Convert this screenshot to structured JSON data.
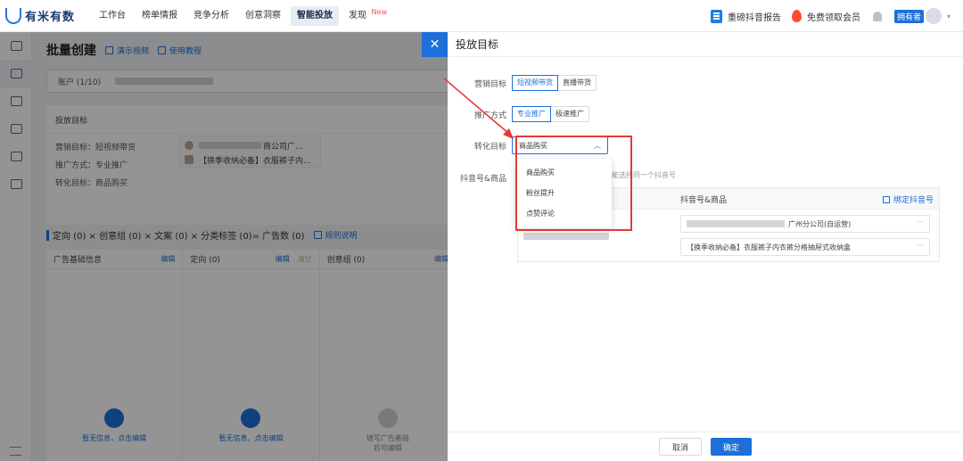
{
  "brand": {
    "name": "有米有数"
  },
  "nav": {
    "items": [
      "工作台",
      "榜单情报",
      "竞争分析",
      "创意洞察",
      "智能投放",
      "发现"
    ],
    "active_index": 4,
    "new_badge": "New"
  },
  "top_right": {
    "report_label": "重磅抖音报告",
    "vip_label": "免费领取会员",
    "owner_badge": "拥有者"
  },
  "page": {
    "title": "批量创建",
    "demo_video": "演示视频",
    "tutorial": "使用教程",
    "account_label": "账户 (1/10)",
    "card_title": "投放目标",
    "kv": {
      "marketing": "营销目标：短视频带货",
      "promotion": "推广方式：专业推广",
      "conversion": "转化目标：商品购买"
    },
    "product_suffix": "商公司广...",
    "product_title": "【换季收纳必备】衣服裤子内...",
    "stats_text": "定向 (0) × 创意组 (0) × 文案 (0) × 分类标签 (0)= 广告数 (0)",
    "rule_link": "规则说明",
    "columns": [
      {
        "title": "广告基础信息",
        "edit": "编辑",
        "empty": "暂无信息，点击编辑"
      },
      {
        "title": "定向 (0)",
        "edit": "编辑",
        "clear": "清空",
        "empty": "暂无信息，点击编辑"
      },
      {
        "title": "创意组 (0)",
        "edit": "编辑",
        "empty_line1": "填写广告基础",
        "empty_line2": "后可编辑"
      }
    ]
  },
  "drawer": {
    "title": "投放目标",
    "marketing": {
      "label": "营销目标",
      "options": [
        "短视频带货",
        "直播带货"
      ],
      "selected": 0
    },
    "promotion": {
      "label": "推广方式",
      "options": [
        "专业推广",
        "极速推广"
      ],
      "selected": 0
    },
    "conversion": {
      "label": "转化目标",
      "value": "商品购买",
      "options": [
        "商品购买",
        "粉丝提升",
        "点赞评论"
      ]
    },
    "account_label": "抖音号&商品",
    "hint": "能选择同一个抖音号",
    "table_header": "抖音号&商品",
    "bind_link": "绑定抖音号",
    "company_suffix": "广州分公司(自运营)",
    "product_select": "【换季收纳必备】衣服裤子内衣裤分格抽屉式收纳盒",
    "cancel": "取消",
    "confirm": "确定"
  },
  "colors": {
    "accent": "#1e6fd9",
    "highlight": "#e53935"
  }
}
